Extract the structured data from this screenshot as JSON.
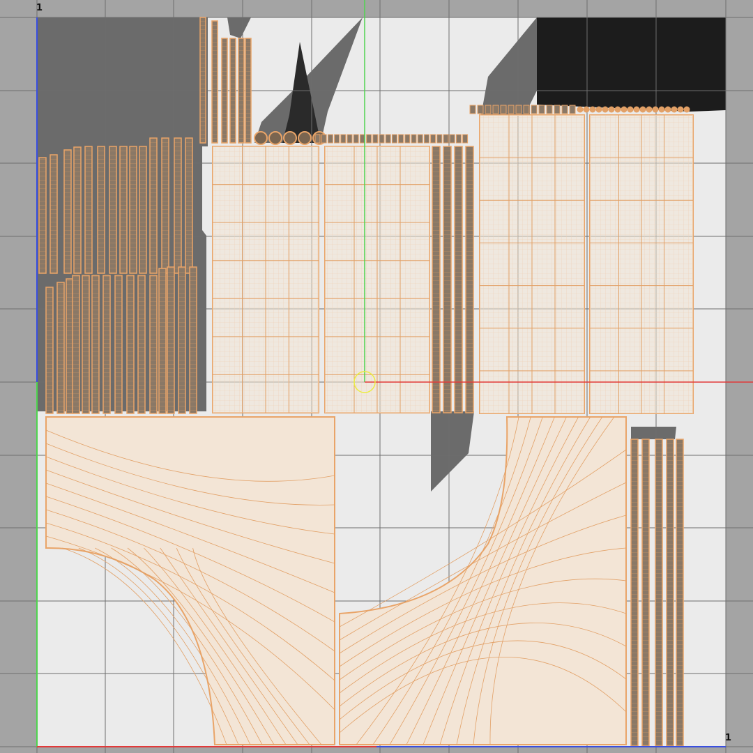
{
  "viewport": {
    "corner_label_top_left": "1",
    "corner_label_bottom_right": "1"
  },
  "colors": {
    "outside_background": "#a4a4a4",
    "uv_tile_background": "#ebebeb",
    "grid_line": "#6e6e6e",
    "shadow_dark": "#6b6b6b",
    "shadow_black": "#1c1c1c",
    "island_fill": "#f3e5d6",
    "island_wire": "#e2a066",
    "island_outline": "#e9a468",
    "axis_u": "#e23a3a",
    "axis_v": "#4fd34f",
    "axis_blue": "#3a4fe0",
    "pivot": "#ecec40"
  },
  "icons": {
    "pivot": "pivot-circle-icon"
  },
  "islands": {
    "grid_panels": 4,
    "curved_panels": 2,
    "strip_groups": 5,
    "small_chip_rows": 2
  }
}
